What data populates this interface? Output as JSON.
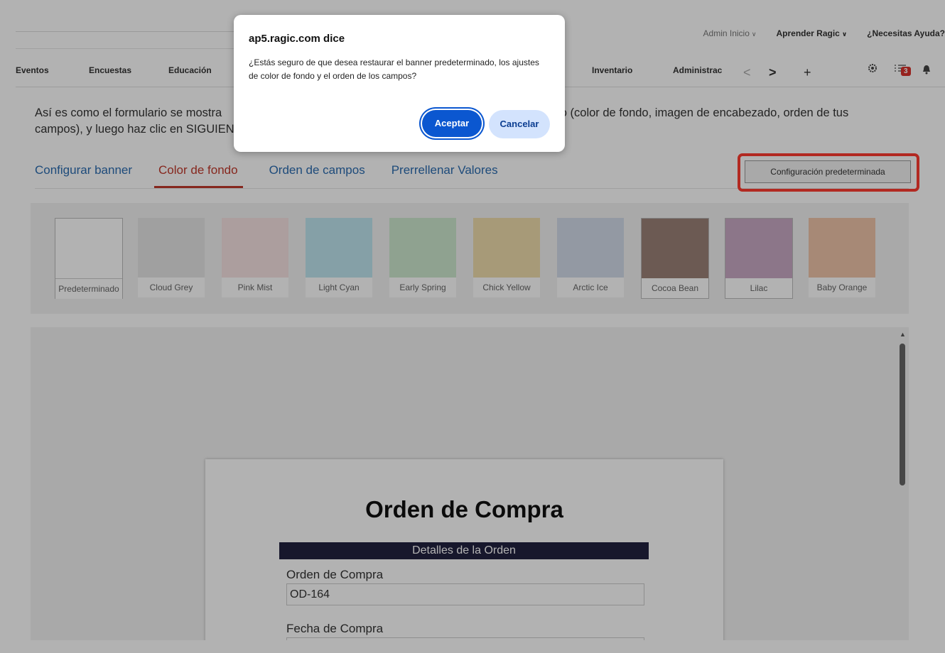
{
  "header": {
    "links": [
      {
        "label": "Admin Inicio",
        "chevron": true,
        "bold": false
      },
      {
        "label": "Aprender Ragic",
        "chevron": true,
        "bold": true
      },
      {
        "label": "¿Necesitas Ayuda?",
        "chevron": false,
        "bold": true
      }
    ]
  },
  "nav": {
    "items": [
      "Eventos",
      "Encuestas",
      "Educación",
      "Inventario",
      "Administrac"
    ],
    "prev_glyph": "<",
    "next_glyph": ">",
    "add_glyph": "+",
    "task_count": "3"
  },
  "intro": {
    "text_left_line1": "Así es como el formulario se mostra",
    "text_right_line1": "seño (color de fondo, imagen de encabezado, orden de tus",
    "text_line2": "campos), y luego haz clic en SIGUIEN"
  },
  "tabs": [
    {
      "label": "Configurar banner",
      "active": false
    },
    {
      "label": "Color de fondo",
      "active": true
    },
    {
      "label": "Orden de campos",
      "active": false
    },
    {
      "label": "Prerrellenar Valores",
      "active": false
    }
  ],
  "default_button_label": "Configuración predeterminada",
  "swatches": [
    {
      "name": "Predeterminado",
      "color": "#ffffff"
    },
    {
      "name": "Cloud Grey",
      "color": "#e6e6e6"
    },
    {
      "name": "Pink Mist",
      "color": "#f6e2e2"
    },
    {
      "name": "Light Cyan",
      "color": "#bfe6f0"
    },
    {
      "name": "Early Spring",
      "color": "#cde8cf"
    },
    {
      "name": "Chick Yellow",
      "color": "#efddac"
    },
    {
      "name": "Arctic Ice",
      "color": "#d3dcea"
    },
    {
      "name": "Cocoa Bean",
      "color": "#9b8178"
    },
    {
      "name": "Lilac",
      "color": "#c9a9c4"
    },
    {
      "name": "Baby Orange",
      "color": "#f0c4aa"
    }
  ],
  "form": {
    "title": "Orden de Compra",
    "section": "Detalles de la Orden",
    "fields": [
      {
        "label": "Orden de Compra",
        "value": "OD-164"
      },
      {
        "label": "Fecha de Compra",
        "value": ""
      }
    ]
  },
  "dialog": {
    "title": "ap5.ragic.com dice",
    "message": "¿Estás seguro de que desea restaurar el banner predeterminado, los ajustes de color de fondo y el orden de los campos?",
    "accept_label": "Aceptar",
    "cancel_label": "Cancelar"
  },
  "colors": {
    "accent_blue": "#0b57d0",
    "active_tab_red": "#c0392b",
    "highlight_red": "#ff3b30",
    "section_bar": "#22213f"
  }
}
